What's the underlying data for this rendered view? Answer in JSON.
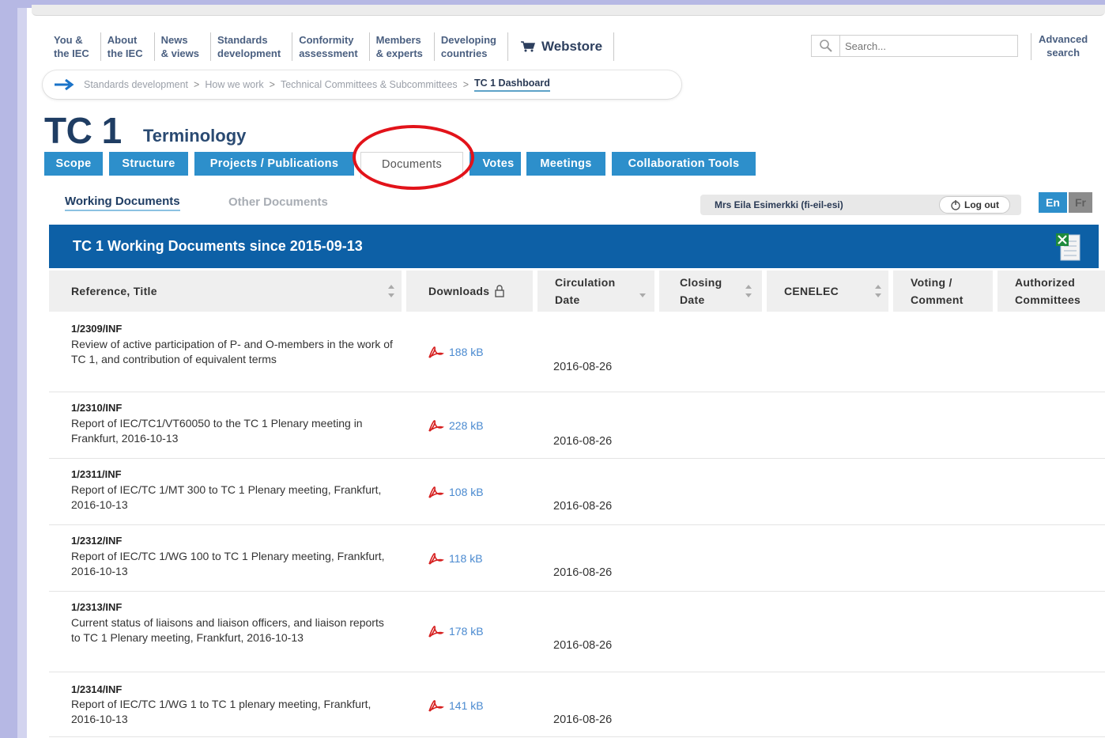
{
  "nav": {
    "items": [
      {
        "line1": "You &",
        "line2": "the IEC"
      },
      {
        "line1": "About",
        "line2": "the IEC"
      },
      {
        "line1": "News",
        "line2": "& views"
      },
      {
        "line1": "Standards",
        "line2": "development"
      },
      {
        "line1": "Conformity",
        "line2": "assessment"
      },
      {
        "line1": "Members",
        "line2": "& experts"
      },
      {
        "line1": "Developing",
        "line2": "countries"
      }
    ],
    "webstore": "Webstore",
    "search_placeholder": "Search...",
    "advanced_line1": "Advanced",
    "advanced_line2": "search"
  },
  "breadcrumb": {
    "items": [
      "Standards development",
      "How we work",
      "Technical Committees & Subcommittees"
    ],
    "separator": ">",
    "current": "TC 1 Dashboard"
  },
  "committee": {
    "code": "TC 1",
    "name": "Terminology"
  },
  "tabs": [
    {
      "label": "Scope"
    },
    {
      "label": "Structure"
    },
    {
      "label": "Projects / Publications"
    },
    {
      "label": "Documents",
      "active": true
    },
    {
      "label": "Votes"
    },
    {
      "label": "Meetings"
    },
    {
      "label": "Collaboration Tools"
    }
  ],
  "subtabs": {
    "working": "Working Documents",
    "other": "Other Documents"
  },
  "user": {
    "name": "Mrs Eila Esimerkki (fi-eil-esi)",
    "logout": "Log out"
  },
  "languages": {
    "en": "En",
    "fr": "Fr"
  },
  "table": {
    "title": "TC 1 Working Documents since 2015-09-13",
    "columns": {
      "ref_title": "Reference, Title",
      "downloads": "Downloads",
      "circ_1": "Circulation",
      "circ_2": "Date",
      "closing_1": "Closing",
      "closing_2": "Date",
      "cenelec": "CENELEC",
      "voting_1": "Voting /",
      "voting_2": "Comment",
      "auth_1": "Authorized",
      "auth_2": "Committees"
    },
    "rows": [
      {
        "ref": "1/2309/INF",
        "title": "Review of active participation of P- and O-members in the work of TC 1, and contribution of equivalent terms",
        "size": "188 kB",
        "circulation": "2016-08-26"
      },
      {
        "ref": "1/2310/INF",
        "title": "Report of IEC/TC1/VT60050 to the TC 1 Plenary meeting in Frankfurt, 2016-10-13",
        "size": "228 kB",
        "circulation": "2016-08-26"
      },
      {
        "ref": "1/2311/INF",
        "title": "Report of IEC/TC 1/MT 300 to TC 1 Plenary meeting, Frankfurt, 2016-10-13",
        "size": "108 kB",
        "circulation": "2016-08-26"
      },
      {
        "ref": "1/2312/INF",
        "title": "Report of IEC/TC 1/WG 100 to TC 1 Plenary meeting, Frankfurt, 2016-10-13",
        "size": "118 kB",
        "circulation": "2016-08-26"
      },
      {
        "ref": "1/2313/INF",
        "title": "Current status of liaisons and liaison officers, and liaison reports to TC 1 Plenary meeting, Frankfurt, 2016-10-13",
        "size": "178 kB",
        "circulation": "2016-08-26"
      },
      {
        "ref": "1/2314/INF",
        "title": "Report of IEC/TC 1/WG 1 to TC 1 plenary meeting, Frankfurt, 2016-10-13",
        "size": "141 kB",
        "circulation": "2016-08-26"
      }
    ]
  },
  "colors": {
    "tab_blue": "#2d8fcb",
    "header_blue": "#0d60a6",
    "title_navy": "#1f3d63",
    "highlight_red": "#e2131a",
    "link_blue": "#4a8ad0"
  }
}
